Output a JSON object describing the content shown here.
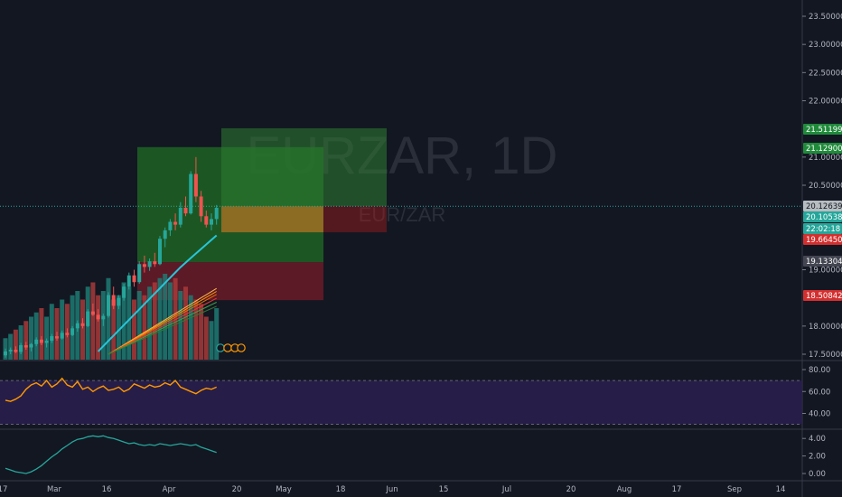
{
  "chart_data": {
    "type": "candlestick",
    "symbol": "EURZAR, 1D",
    "symbol_sub": "EUR/ZAR",
    "main_y_ticks": [
      "23.50000",
      "23.00000",
      "22.50000",
      "22.00000",
      "21.00000",
      "20.50000",
      "19.00000",
      "18.00000",
      "17.50000"
    ],
    "main_y_values": [
      23.5,
      23.0,
      22.5,
      22.0,
      21.0,
      20.5,
      19.0,
      18.0,
      17.5
    ],
    "price_labels": [
      {
        "text": "21.51199",
        "value": 21.51199,
        "color": "#26a69a",
        "bg": "#1f8a3a"
      },
      {
        "text": "21.12900",
        "value": 21.129,
        "color": "#26a69a",
        "bg": "#1f8a3a"
      },
      {
        "text": "20.12639",
        "value": 20.12639,
        "color": "#26a69a",
        "bg": "#a8b0b3"
      },
      {
        "text": "20.10538",
        "value": 20.10538,
        "color": "#26a69a",
        "bg": "#26a69a"
      },
      {
        "text": "22:02:18",
        "value": 19.93,
        "color": "#26a69a",
        "bg": "#26a69a"
      },
      {
        "text": "19.66450",
        "value": 19.6645,
        "color": "#ef5350",
        "bg": "#d32f2f"
      },
      {
        "text": "19.13304",
        "value": 19.13304,
        "color": "#434651",
        "bg": "#434651"
      },
      {
        "text": "18.50842",
        "value": 18.50842,
        "color": "#ef5350",
        "bg": "#d32f2f"
      }
    ],
    "rsi_ticks": [
      "80.00",
      "60.00",
      "40.00"
    ],
    "rsi_values": [
      80,
      60,
      40
    ],
    "osc_ticks": [
      "4.00",
      "2.00",
      "0.00"
    ],
    "osc_values": [
      4,
      2,
      0
    ],
    "x_ticks": [
      "17",
      "Mar",
      "16",
      "Apr",
      "20",
      "May",
      "18",
      "Jun",
      "15",
      "Jul",
      "20",
      "Aug",
      "17",
      "Sep",
      "14"
    ],
    "candles": [
      [
        17.48,
        17.6,
        17.44,
        17.55
      ],
      [
        17.55,
        17.62,
        17.5,
        17.58
      ],
      [
        17.58,
        17.64,
        17.52,
        17.54
      ],
      [
        17.54,
        17.7,
        17.5,
        17.66
      ],
      [
        17.66,
        17.72,
        17.58,
        17.62
      ],
      [
        17.62,
        17.7,
        17.55,
        17.68
      ],
      [
        17.68,
        17.8,
        17.64,
        17.76
      ],
      [
        17.76,
        17.82,
        17.66,
        17.7
      ],
      [
        17.7,
        17.78,
        17.62,
        17.74
      ],
      [
        17.74,
        17.86,
        17.7,
        17.82
      ],
      [
        17.82,
        17.9,
        17.74,
        17.78
      ],
      [
        17.78,
        17.92,
        17.76,
        17.88
      ],
      [
        17.88,
        17.96,
        17.8,
        17.84
      ],
      [
        17.84,
        18.0,
        17.82,
        17.96
      ],
      [
        17.96,
        18.1,
        17.9,
        18.05
      ],
      [
        18.05,
        18.14,
        17.96,
        18.0
      ],
      [
        18.0,
        18.3,
        17.98,
        18.26
      ],
      [
        18.26,
        18.4,
        18.18,
        18.2
      ],
      [
        18.2,
        18.3,
        18.08,
        18.12
      ],
      [
        18.12,
        18.22,
        18.0,
        18.18
      ],
      [
        18.18,
        18.6,
        18.15,
        18.55
      ],
      [
        18.55,
        18.7,
        18.3,
        18.36
      ],
      [
        18.36,
        18.55,
        18.3,
        18.5
      ],
      [
        18.5,
        18.75,
        18.45,
        18.7
      ],
      [
        18.7,
        18.95,
        18.65,
        18.9
      ],
      [
        18.9,
        19.0,
        18.7,
        18.78
      ],
      [
        18.78,
        19.15,
        18.75,
        19.1
      ],
      [
        19.1,
        19.25,
        18.95,
        19.05
      ],
      [
        19.05,
        19.2,
        18.98,
        19.15
      ],
      [
        19.15,
        19.3,
        19.05,
        19.1
      ],
      [
        19.1,
        19.6,
        19.08,
        19.55
      ],
      [
        19.55,
        19.75,
        19.4,
        19.7
      ],
      [
        19.7,
        19.9,
        19.6,
        19.85
      ],
      [
        19.85,
        20.0,
        19.7,
        19.8
      ],
      [
        19.8,
        20.2,
        19.75,
        20.1
      ],
      [
        20.1,
        20.3,
        19.95,
        20.0
      ],
      [
        20.0,
        20.75,
        19.98,
        20.7
      ],
      [
        20.7,
        21.0,
        20.2,
        20.3
      ],
      [
        20.3,
        20.4,
        19.85,
        19.95
      ],
      [
        19.95,
        20.05,
        19.75,
        19.8
      ],
      [
        19.8,
        20.0,
        19.7,
        19.9
      ],
      [
        19.9,
        20.15,
        19.8,
        20.1
      ]
    ],
    "rsi": [
      52,
      51,
      53,
      56,
      62,
      66,
      68,
      65,
      70,
      64,
      67,
      72,
      66,
      64,
      69,
      62,
      64,
      60,
      63,
      65,
      61,
      62,
      64,
      60,
      62,
      67,
      65,
      63,
      66,
      64,
      65,
      68,
      66,
      70,
      64,
      62,
      60,
      58,
      61,
      63,
      62,
      64
    ],
    "osc": [
      0.6,
      0.4,
      0.2,
      0.1,
      0.0,
      0.2,
      0.5,
      0.9,
      1.4,
      1.9,
      2.3,
      2.8,
      3.2,
      3.6,
      3.9,
      4.0,
      4.2,
      4.3,
      4.2,
      4.3,
      4.1,
      4.0,
      3.8,
      3.6,
      3.4,
      3.5,
      3.3,
      3.2,
      3.3,
      3.2,
      3.4,
      3.3,
      3.2,
      3.3,
      3.4,
      3.3,
      3.2,
      3.3,
      3.0,
      2.8,
      2.6,
      2.4
    ],
    "volume": [
      0.25,
      0.3,
      0.35,
      0.4,
      0.45,
      0.5,
      0.55,
      0.6,
      0.5,
      0.65,
      0.6,
      0.7,
      0.65,
      0.75,
      0.8,
      0.7,
      0.85,
      0.9,
      0.75,
      0.8,
      0.95,
      0.7,
      0.75,
      0.9,
      0.85,
      0.7,
      0.8,
      0.75,
      0.85,
      0.9,
      0.95,
      1.0,
      0.9,
      0.95,
      0.8,
      0.85,
      0.75,
      0.7,
      0.65,
      0.5,
      0.45,
      0.6
    ],
    "position_long": {
      "entry": 20.12639,
      "target": 21.51199,
      "stop": 19.6645,
      "color_profit": "#1b5e20",
      "color_loss": "#6d1c25"
    },
    "position_old": {
      "entry": 19.13304,
      "target": 21.129,
      "stop": 18.50842
    }
  },
  "colors": {
    "up": "#26a69a",
    "down": "#ef5350",
    "ema": "#26c6da",
    "rsi": "#ff9800",
    "osc": "#26a69a",
    "bg": "#131722",
    "grid": "#1e222d"
  }
}
